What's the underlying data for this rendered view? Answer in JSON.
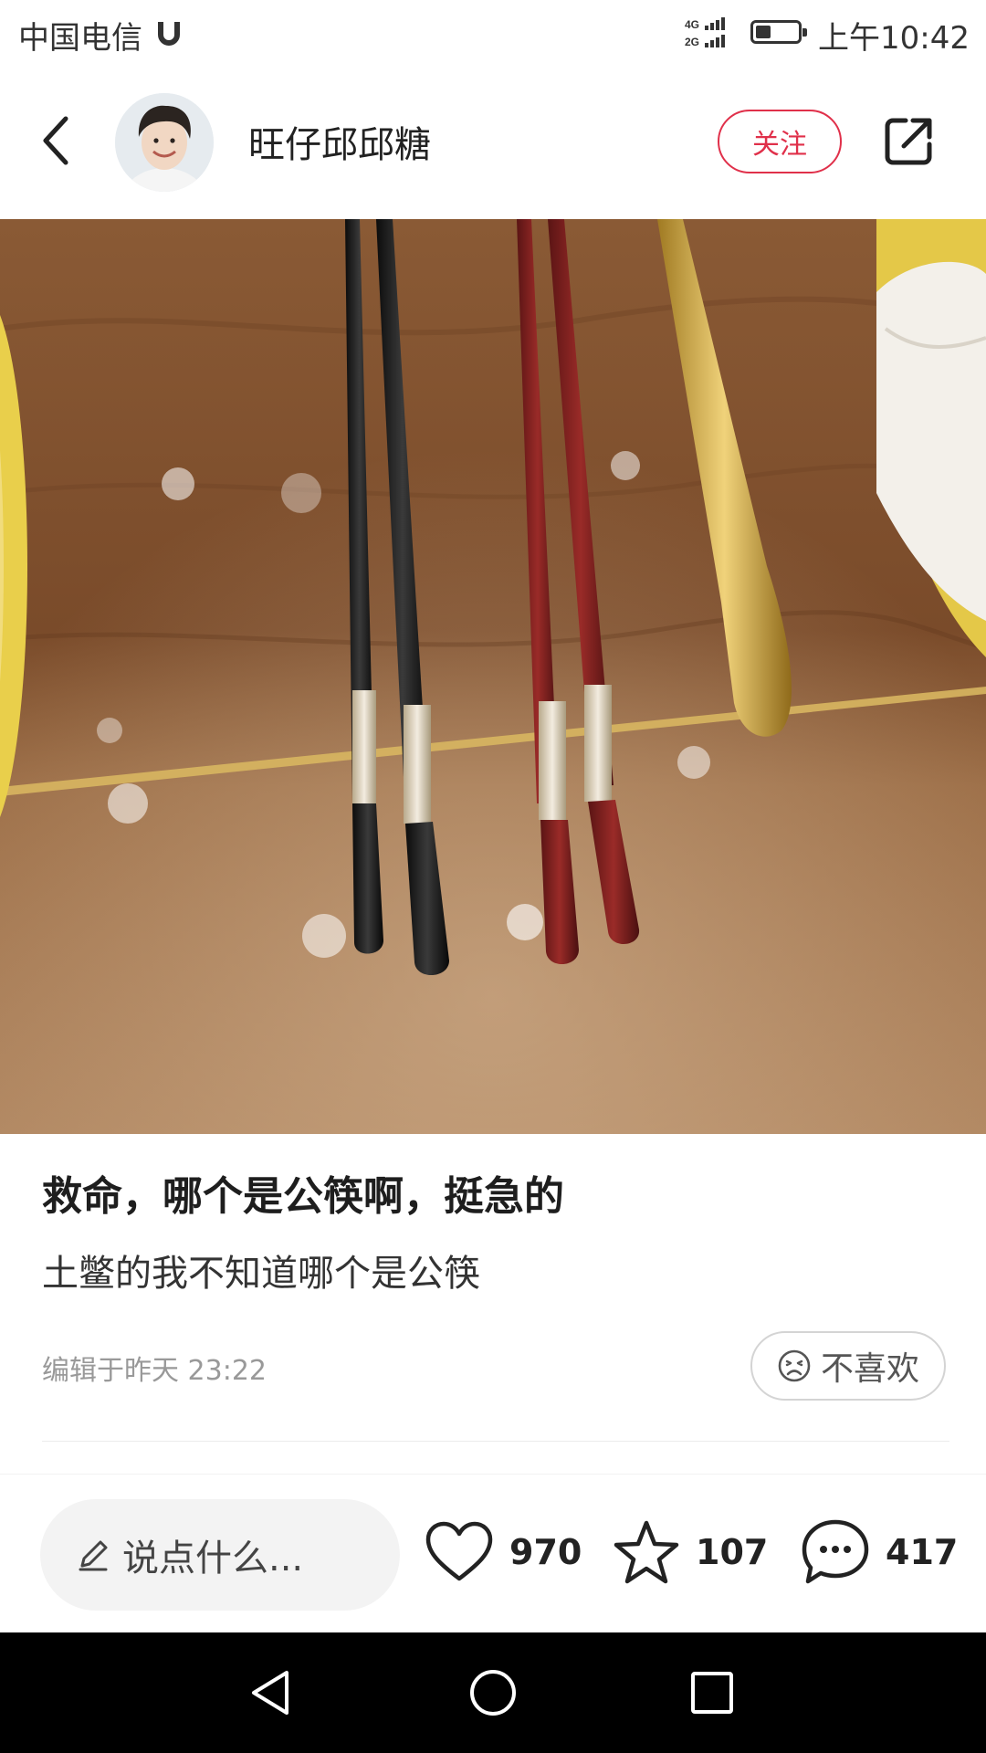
{
  "status_bar": {
    "carrier": "中国电信",
    "network": "4G 2G",
    "time": "上午10:42"
  },
  "header": {
    "username": "旺仔邱邱糖",
    "follow_label": "关注"
  },
  "post": {
    "title": "救命，哪个是公筷啊，挺急的",
    "body": "土鳖的我不知道哪个是公筷",
    "edited": "编辑于昨天 23:22",
    "dislike_label": "不喜欢"
  },
  "bottom_bar": {
    "comment_placeholder": "说点什么...",
    "likes": "970",
    "favorites": "107",
    "comments": "417"
  },
  "icons": {
    "back": "back-arrow-icon",
    "share": "share-icon",
    "like": "heart-icon",
    "favorite": "star-icon",
    "comment": "comment-bubble-icon",
    "edit": "pencil-icon",
    "dislike": "sad-face-icon"
  },
  "colors": {
    "accent": "#e0304a",
    "table": "#8a5a35"
  }
}
